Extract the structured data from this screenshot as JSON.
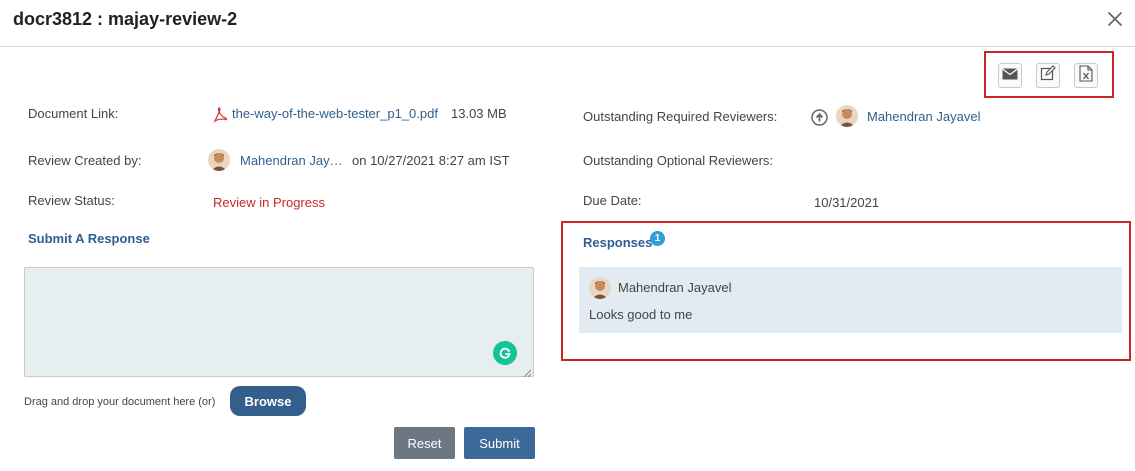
{
  "dialog": {
    "title": "docr3812 : majay-review-2"
  },
  "actions": {
    "icons": [
      "email-icon",
      "edit-icon",
      "excel-export-icon"
    ]
  },
  "details": {
    "document_link_label": "Document Link:",
    "document_name": "the-way-of-the-web-tester_p1_0.pdf",
    "document_size": "13.03 MB",
    "created_by_label": "Review Created by:",
    "creator_name": "Mahendran Jay…",
    "created_on": "on 10/27/2021 8:27 am IST",
    "status_label": "Review Status:",
    "status_value": "Review in Progress",
    "required_reviewers_label": "Outstanding Required Reviewers:",
    "required_reviewer_name": "Mahendran Jayavel",
    "optional_reviewers_label": "Outstanding Optional Reviewers:",
    "due_date_label": "Due Date:",
    "due_date_value": "10/31/2021"
  },
  "submit_section": {
    "title": "Submit A Response",
    "textarea_value": "",
    "drag_text": "Drag and drop your document here (or)",
    "browse_label": "Browse",
    "reset_label": "Reset",
    "submit_label": "Submit"
  },
  "responses": {
    "title": "Responses",
    "count": "1",
    "items": [
      {
        "author": "Mahendran Jayavel",
        "text": "Looks good to me"
      }
    ]
  },
  "colors": {
    "accent": "#2f5f8f",
    "status_red": "#c62828",
    "highlight_border": "#c62828",
    "badge": "#2e9fd8"
  }
}
